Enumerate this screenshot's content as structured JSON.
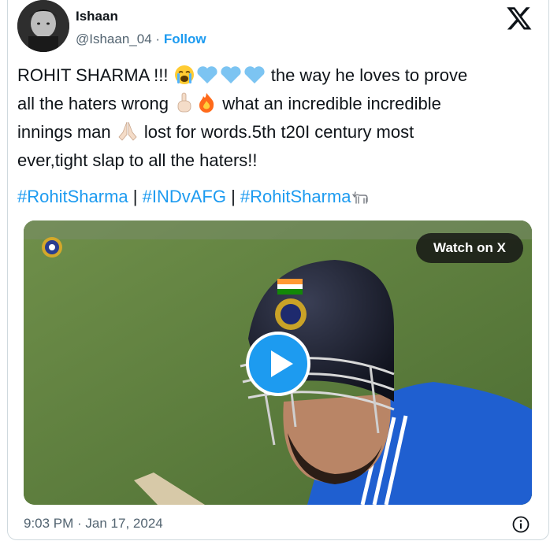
{
  "author": {
    "name": "Ishaan",
    "handle": "@Ishaan_04",
    "separator": "·",
    "follow_label": "Follow"
  },
  "brand": {
    "icon": "x-logo-icon",
    "color": "#0f1419"
  },
  "tweet": {
    "line1_text": "ROHIT SHARMA !!! ",
    "line1_emojis": [
      "loudly-crying-face",
      "light-blue-heart",
      "light-blue-heart",
      "light-blue-heart"
    ],
    "line1_rest": " the way he loves to prove",
    "line2_text": "all the haters wrong ",
    "line2_emojis": [
      "index-pointing-up",
      "fire"
    ],
    "line2_rest": " what an incredible incredible",
    "line3_text": "innings man ",
    "line3_emoji": "folded-hands",
    "line3_rest": " lost for words.5th t20I century most",
    "line4_text": "ever,tight slap to all the haters!!",
    "hashtags": [
      "#RohitSharma",
      "#INDvAFG",
      "#RohitSharma"
    ],
    "hashtag_separator": " | ",
    "trailing_emoji": "goat"
  },
  "media": {
    "watch_label": "Watch on X",
    "play_icon": "play-icon",
    "colors": {
      "field": "#5b7a3c",
      "jersey": "#1f5fd0",
      "helmet": "#1a1d2b",
      "play": "#1d9bf0"
    }
  },
  "footer": {
    "timestamp": "9:03 PM · Jan 17, 2024",
    "info_icon": "info-icon"
  },
  "accent": "#1d9bf0",
  "secondary_text": "#536471"
}
